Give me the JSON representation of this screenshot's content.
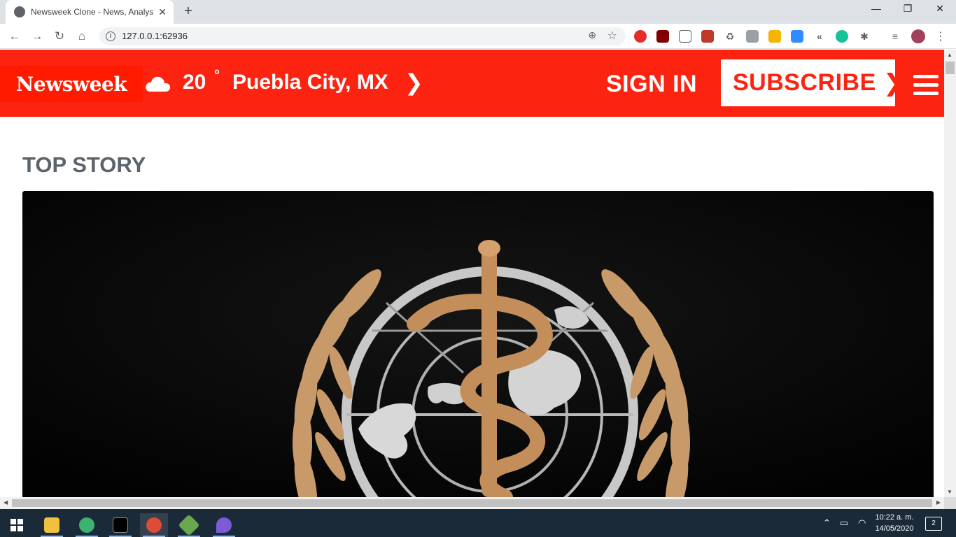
{
  "browser": {
    "tab_title": "Newsweek Clone - News, Analysis, Politics",
    "tab_close": "✕",
    "new_tab": "+",
    "url": "127.0.0.1:62936",
    "window_controls": {
      "minimize": "—",
      "restore": "❐",
      "close": "✕"
    }
  },
  "header": {
    "logo": "Newsweek",
    "weather_icon": "cloud-icon",
    "temperature": "20",
    "degree": "°",
    "city": "Puebla City, MX",
    "city_arrow": "❯",
    "sign_in": "SIGN IN",
    "subscribe": "SUBSCRIBE",
    "subscribe_arrow": "❯",
    "menu_icon": "hamburger-icon",
    "brand_color": "#fc2311"
  },
  "main": {
    "section_title": "TOP STORY",
    "hero_image": "world-health-organization-emblem"
  },
  "taskbar": {
    "time": "10:22 a. m.",
    "date": "14/05/2020",
    "notifications": "2"
  }
}
